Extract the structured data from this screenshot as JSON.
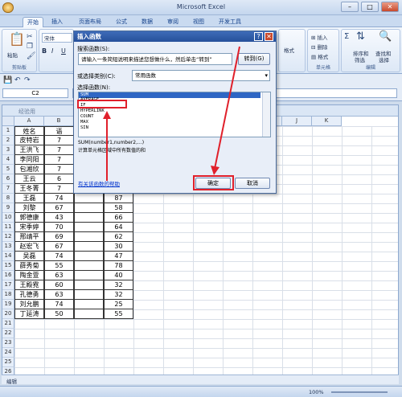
{
  "window": {
    "title": "Microsoft Excel",
    "min": "–",
    "max": "□",
    "close": "✕"
  },
  "tabs": [
    "开始",
    "插入",
    "页面布局",
    "公式",
    "数据",
    "审阅",
    "视图",
    "开发工具"
  ],
  "ribbon": {
    "paste": "粘贴",
    "font_name": "宋体",
    "bold": "B",
    "italic": "I",
    "underline": "U",
    "clipboard_label": "剪贴板",
    "insert": "插入",
    "delete": "删除",
    "format": "格式",
    "cells_label": "单元格",
    "sort": "排序和\n筛选",
    "sort_line1": "排序和",
    "sort_line2": "筛选",
    "find_line1": "查找和",
    "find_line2": "选择",
    "editing_label": "编辑",
    "style_text": "格式",
    "sigma": "Σ"
  },
  "formula_bar": {
    "cell_ref": "C2"
  },
  "sheet": {
    "title": "经验用",
    "columns": [
      "A",
      "B",
      "C",
      "D",
      "E",
      "F",
      "G",
      "H",
      "I",
      "J",
      "K"
    ],
    "rows": [
      "1",
      "2",
      "3",
      "4",
      "5",
      "6",
      "7",
      "8",
      "9",
      "10",
      "11",
      "12",
      "13",
      "14",
      "15",
      "16",
      "17",
      "18",
      "19",
      "20",
      "21",
      "22",
      "23",
      "24",
      "25",
      "26"
    ],
    "col_a": [
      "姓名",
      "皮特岩",
      "王洪飞",
      "李同阳",
      "包湘欣",
      "王云",
      "王冬菁",
      "王磊",
      "刘黎",
      "郭德康",
      "宋季婷",
      "邢靖平",
      "赵宏飞",
      "吴磊",
      "薛秀菊",
      "陶金萱",
      "王殿霓",
      "孔德勇",
      "刘允鹏",
      "丁延涛"
    ],
    "col_b": [
      "语",
      "7",
      "7",
      "7",
      "7",
      "6",
      "7",
      "74",
      "67",
      "43",
      "70",
      "69",
      "67",
      "74",
      "55",
      "63",
      "60",
      "63",
      "74",
      "50"
    ],
    "col_d": [
      "",
      "",
      "",
      "",
      "",
      "",
      "",
      "87",
      "58",
      "66",
      "64",
      "62",
      "30",
      "47",
      "78",
      "40",
      "32",
      "32",
      "25",
      "55"
    ]
  },
  "sheet_tab": "编辑",
  "status": {
    "zoom": "100%"
  },
  "dialog": {
    "title": "插入函数",
    "help": "?",
    "close": "✕",
    "search_label": "搜索函数(S):",
    "search_value": "请输入一条简短说明来描述您想做什么，然后单击“转到”",
    "go_button": "转到(G)",
    "category_label": "或选择类别(C):",
    "category_value": "常用函数",
    "select_label": "选择函数(N):",
    "functions": [
      "SUM",
      "AVERAGE",
      "IF",
      "HYPERLINK",
      "COUNT",
      "MAX",
      "SIN"
    ],
    "selected_function": "SUM",
    "signature": "SUM(number1,number2,...)",
    "description": "计算单元格区域中所有数值的和",
    "help_link": "有关该函数的帮助",
    "ok": "确定",
    "cancel": "取消"
  }
}
